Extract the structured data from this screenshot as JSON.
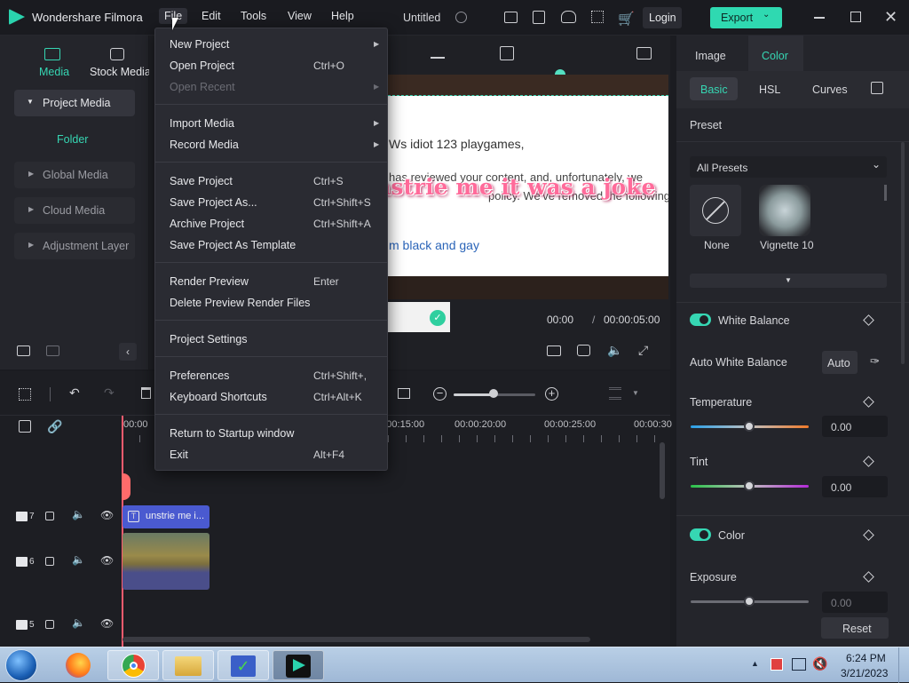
{
  "app": {
    "name": "Wondershare Filmora",
    "project_title": "Untitled",
    "login_label": "Login",
    "export_label": "Export"
  },
  "menubar": {
    "items": [
      "File",
      "Edit",
      "Tools",
      "View",
      "Help"
    ]
  },
  "left_panel": {
    "tabs": [
      "Media",
      "Stock Media"
    ],
    "items": [
      "Project Media",
      "Folder",
      "Global Media",
      "Cloud Media",
      "Adjustment Layer"
    ]
  },
  "preview": {
    "lines": [
      "Ws idiot 123 playgames,",
      "has reviewed your content, and, unfortunately, we",
      "policy. We've removed the following co",
      "m black and gay"
    ],
    "overlay_text": "unstrie me it was a joke",
    "time_current": "00:00",
    "time_sep": "/",
    "time_total": "00:00:05:00"
  },
  "timeline": {
    "ruler": [
      "00:00",
      "00:00:15:00",
      "00:00:20:00",
      "00:00:25:00",
      "00:00:30"
    ],
    "tracks": [
      {
        "num": "7"
      },
      {
        "num": "6"
      },
      {
        "num": "5"
      }
    ],
    "clip_text": "unstrie me i..."
  },
  "right_panel": {
    "tabs": [
      "Image",
      "Color"
    ],
    "subtabs": [
      "Basic",
      "HSL",
      "Curves"
    ],
    "preset_label": "Preset",
    "preset_select": "All Presets",
    "presets": [
      "None",
      "Vignette 10"
    ],
    "white_balance": "White Balance",
    "auto_wb_label": "Auto White Balance",
    "auto_button": "Auto",
    "temperature": {
      "label": "Temperature",
      "value": "0.00"
    },
    "tint": {
      "label": "Tint",
      "value": "0.00"
    },
    "color_section": "Color",
    "exposure": {
      "label": "Exposure",
      "value": "0.00"
    },
    "reset_label": "Reset"
  },
  "file_menu": {
    "new_project": "New Project",
    "open_project": "Open Project",
    "open_project_sc": "Ctrl+O",
    "open_recent": "Open Recent",
    "import_media": "Import Media",
    "record_media": "Record Media",
    "save_project": "Save Project",
    "save_project_sc": "Ctrl+S",
    "save_as": "Save Project As...",
    "save_as_sc": "Ctrl+Shift+S",
    "archive": "Archive Project",
    "archive_sc": "Ctrl+Shift+A",
    "save_template": "Save Project As Template",
    "render_preview": "Render Preview",
    "render_preview_sc": "Enter",
    "delete_preview": "Delete Preview Render Files",
    "project_settings": "Project Settings",
    "preferences": "Preferences",
    "preferences_sc": "Ctrl+Shift+,",
    "shortcuts": "Keyboard Shortcuts",
    "shortcuts_sc": "Ctrl+Alt+K",
    "return_startup": "Return to Startup window",
    "exit": "Exit",
    "exit_sc": "Alt+F4"
  },
  "taskbar": {
    "time": "6:24 PM",
    "date": "3/21/2023"
  },
  "colors": {
    "accent": "#36d6b3",
    "export_bg": "#2fd9b1",
    "cart": "#ff5b6e"
  }
}
